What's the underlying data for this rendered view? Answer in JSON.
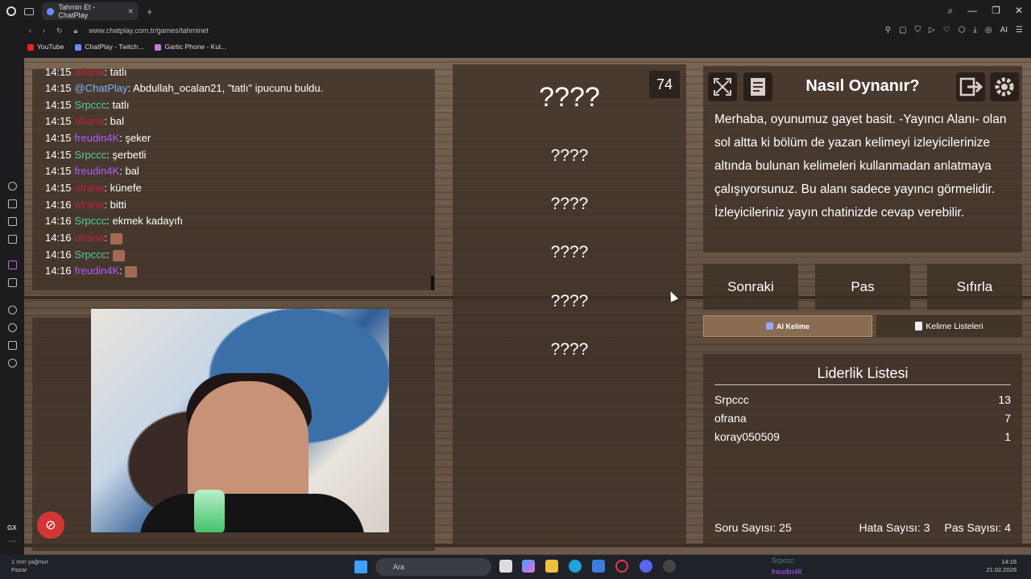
{
  "browser": {
    "tab_title": "Tahmin Et - ChatPlay",
    "url": "www.chatplay.com.tr/games/tahminet",
    "bookmarks": [
      "YouTube",
      "ChatPlay - Twitch...",
      "Gartic Phone - Kul..."
    ],
    "ai_label": "AI"
  },
  "chat": {
    "messages": [
      {
        "time": "14:15",
        "user": "ofrana",
        "user_color": "#c0233a",
        "text": "tatlı",
        "emote": false
      },
      {
        "time": "14:15",
        "user": "@ChatPlay",
        "user_color": "#7fb2ff",
        "text": "Abdullah_ocalan21, \"tatlı\" ipucunu buldu.",
        "emote": false
      },
      {
        "time": "14:15",
        "user": "Srpccc",
        "user_color": "#4fd19a",
        "text": "tatlı",
        "emote": false
      },
      {
        "time": "14:15",
        "user": "ofrana",
        "user_color": "#c0233a",
        "text": "bal",
        "emote": false
      },
      {
        "time": "14:15",
        "user": "freudin4K",
        "user_color": "#b05cff",
        "text": "şeker",
        "emote": false
      },
      {
        "time": "14:15",
        "user": "Srpccc",
        "user_color": "#4fd19a",
        "text": "şerbetli",
        "emote": false
      },
      {
        "time": "14:15",
        "user": "freudin4K",
        "user_color": "#b05cff",
        "text": "bal",
        "emote": false
      },
      {
        "time": "14:15",
        "user": "ofrana",
        "user_color": "#c0233a",
        "text": "künefe",
        "emote": false
      },
      {
        "time": "14:16",
        "user": "ofrana",
        "user_color": "#c0233a",
        "text": "bitti",
        "emote": false
      },
      {
        "time": "14:16",
        "user": "Srpccc",
        "user_color": "#4fd19a",
        "text": "ekmek kadayıfı",
        "emote": false
      },
      {
        "time": "14:16",
        "user": "ofrana",
        "user_color": "#c0233a",
        "text": "",
        "emote": true
      },
      {
        "time": "14:16",
        "user": "Srpccc",
        "user_color": "#4fd19a",
        "text": "",
        "emote": true
      },
      {
        "time": "14:16",
        "user": "freudin4K",
        "user_color": "#b05cff",
        "text": "",
        "emote": true
      }
    ]
  },
  "game": {
    "timer": "74",
    "main_word": "????",
    "words": [
      "????",
      "????",
      "????",
      "????",
      "????"
    ]
  },
  "how_to": {
    "title": "Nasıl Oynanır?",
    "text": "Merhaba, oyunumuz gayet basit. -Yayıncı Alanı- olan sol altta ki bölüm de yazan kelimeyi izleyicilerinize altında bulunan kelimeleri kullanmadan anlatmaya çalışıyorsunuz. Bu alanı sadece yayıncı görmelidir. İzleyicileriniz yayın chatinizde cevap verebilir."
  },
  "actions": {
    "next": "Sonraki",
    "pass": "Pas",
    "reset": "Sıfırla",
    "ai_word": "AI Kelime",
    "word_lists": "Kelime Listeleri"
  },
  "leaderboard": {
    "title": "Liderlik Listesi",
    "rows": [
      {
        "name": "Srpccc",
        "score": "13"
      },
      {
        "name": "ofrana",
        "score": "7"
      },
      {
        "name": "koray050509",
        "score": "1"
      }
    ],
    "question_count_label": "Soru Sayısı:",
    "question_count": "25",
    "error_count_label": "Hata Sayısı:",
    "error_count": "3",
    "pass_count_label": "Pas Sayısı:",
    "pass_count": "4"
  },
  "taskbar": {
    "weather": "1 mm yağmur",
    "weather_sub": "Pazar",
    "search_placeholder": "Ara",
    "notif_user1": "Srpccc",
    "notif_user2": "freudin4K",
    "clock_time": "14:16",
    "clock_date": "21.02.2026"
  },
  "colors": {
    "chat_red": "#c0233a",
    "chat_green": "#4fd19a",
    "chat_purple": "#b05cff",
    "chat_blue": "#7fb2ff"
  }
}
